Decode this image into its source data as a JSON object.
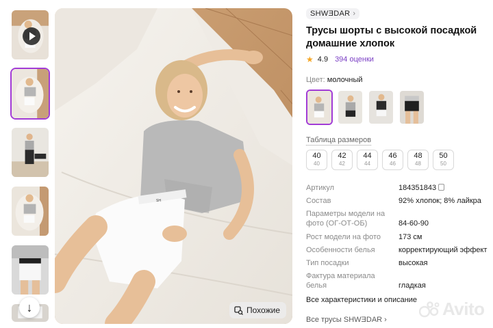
{
  "product": {
    "brand": "SHWƎDAR",
    "title": "Трусы шорты с высокой посадкой домашние хлопок",
    "rating": "4.9",
    "reviews": "394 оценки",
    "color_label": "Цвет:",
    "color_value": "молочный"
  },
  "gallery": {
    "similar_label": "Похожие"
  },
  "sizes_section": {
    "table_link": "Таблица размеров",
    "sizes": [
      {
        "ru": "40",
        "intl": "40"
      },
      {
        "ru": "42",
        "intl": "42"
      },
      {
        "ru": "44",
        "intl": "44"
      },
      {
        "ru": "46",
        "intl": "46"
      },
      {
        "ru": "48",
        "intl": "48"
      },
      {
        "ru": "50",
        "intl": "50"
      }
    ]
  },
  "specs": {
    "article_label": "Артикул",
    "article_value": "184351843",
    "composition_label": "Состав",
    "composition_value": "92% хлопок; 8% лайкра",
    "model_params_label_1": "Параметры модели на",
    "model_params_label_2": "фото (ОГ-ОТ-ОБ)",
    "model_params_value": "84-60-90",
    "model_height_label": "Рост модели на фото",
    "model_height_value": "173 см",
    "feature_label": "Особенности белья",
    "feature_value": "корректирующий эффект",
    "rise_label": "Тип посадки",
    "rise_value": "высокая",
    "texture_label_1": "Фактура материала",
    "texture_label_2": "белья",
    "texture_value": "гладкая"
  },
  "links": {
    "all_characteristics": "Все характеристики и описание",
    "all_brand": "Все трусы SHWƎDAR"
  },
  "watermark": {
    "text": "Avito"
  },
  "colors": {
    "accent": "#a23bd6",
    "link": "#7a3ec4",
    "star": "#f5a623"
  }
}
